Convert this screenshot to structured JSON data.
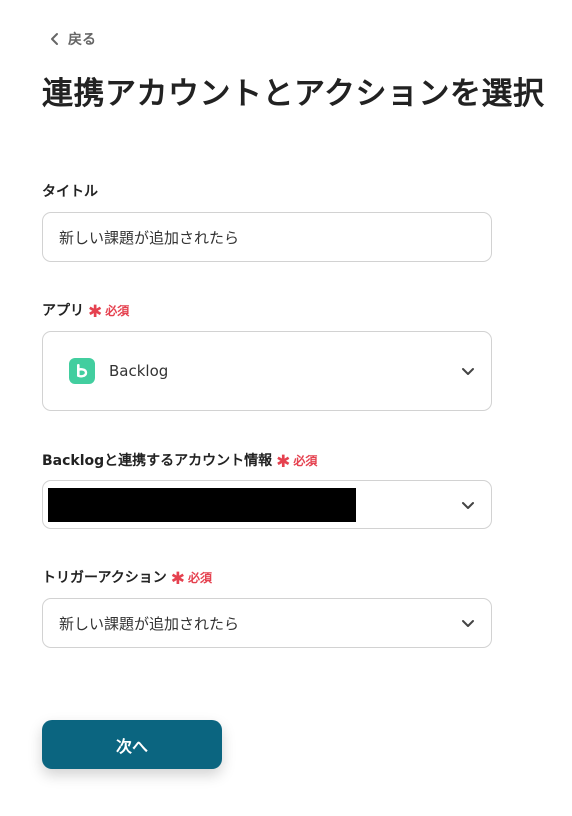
{
  "nav": {
    "back_label": "戻る"
  },
  "page": {
    "title": "連携アカウントとアクションを選択"
  },
  "required_label": "必須",
  "fields": {
    "title": {
      "label": "タイトル",
      "value": "新しい課題が追加されたら"
    },
    "app": {
      "label": "アプリ",
      "value": "Backlog",
      "icon": "backlog-logo",
      "icon_color": "#42ce9f"
    },
    "account": {
      "label": "Backlogと連携するアカウント情報",
      "value": ""
    },
    "trigger": {
      "label": "トリガーアクション",
      "value": "新しい課題が追加されたら"
    }
  },
  "actions": {
    "next_label": "次へ"
  },
  "colors": {
    "primary": "#0b6580",
    "required": "#e5414f",
    "border": "#d2d2d2"
  }
}
